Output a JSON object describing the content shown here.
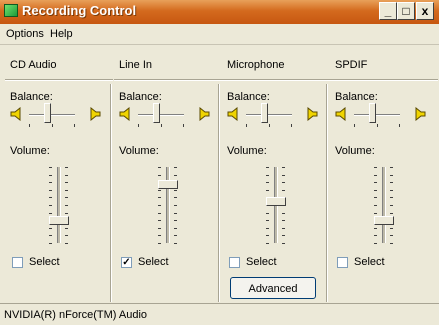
{
  "window": {
    "title": "Recording Control",
    "title_bar_buttons": [
      "_",
      "□",
      "x"
    ]
  },
  "menu": [
    "Options",
    "Help"
  ],
  "balance_label": "Balance:",
  "volume_label": "Volume:",
  "select_label": "Select",
  "columns": [
    {
      "name": "CD Audio",
      "balance": 0.4,
      "volume": 0.3,
      "selected": false,
      "advanced": null
    },
    {
      "name": "Line In",
      "balance": 0.4,
      "volume": 0.78,
      "selected": true,
      "advanced": null
    },
    {
      "name": "Microphone",
      "balance": 0.4,
      "volume": 0.55,
      "selected": false,
      "advanced": "Advanced"
    },
    {
      "name": "SPDIF",
      "balance": 0.4,
      "volume": 0.3,
      "selected": false,
      "advanced": null
    }
  ],
  "status": "NVIDIA(R) nForce(TM) Audio",
  "colors": {
    "titlebar": "#d46a1e",
    "face": "#ece9d8",
    "check": "#000000"
  }
}
